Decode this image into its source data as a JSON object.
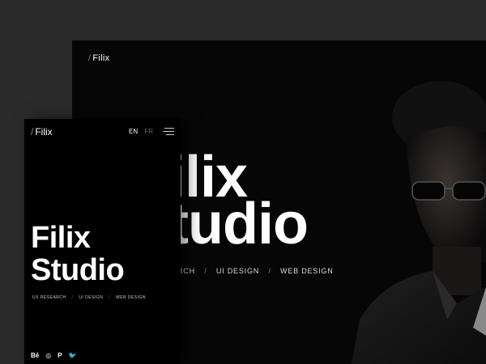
{
  "desktop": {
    "logo_slash": "/",
    "logo": "Filix",
    "title_line1": "ilix",
    "title_line2": "tudio",
    "tags": [
      "RCH",
      "UI DESIGN",
      "WEB DESIGN"
    ]
  },
  "mobile": {
    "logo_slash": "/",
    "logo": "Filix",
    "lang_en": "EN",
    "lang_fr": "FR",
    "title_line1": "Filix",
    "title_line2": "Studio",
    "tags": [
      "UX RESEARCH",
      "UI DESIGN",
      "WEB DESIGN"
    ],
    "social": [
      "Bē",
      "◎",
      "P",
      "🐦"
    ]
  },
  "icons": {
    "menu": "hamburger-menu-icon",
    "social": [
      "behance-icon",
      "dribbble-icon",
      "pinterest-icon",
      "twitter-icon"
    ]
  },
  "colors": {
    "background": "#2b2b2b",
    "panel": "#000000",
    "text": "#ffffff",
    "muted": "#666666"
  }
}
